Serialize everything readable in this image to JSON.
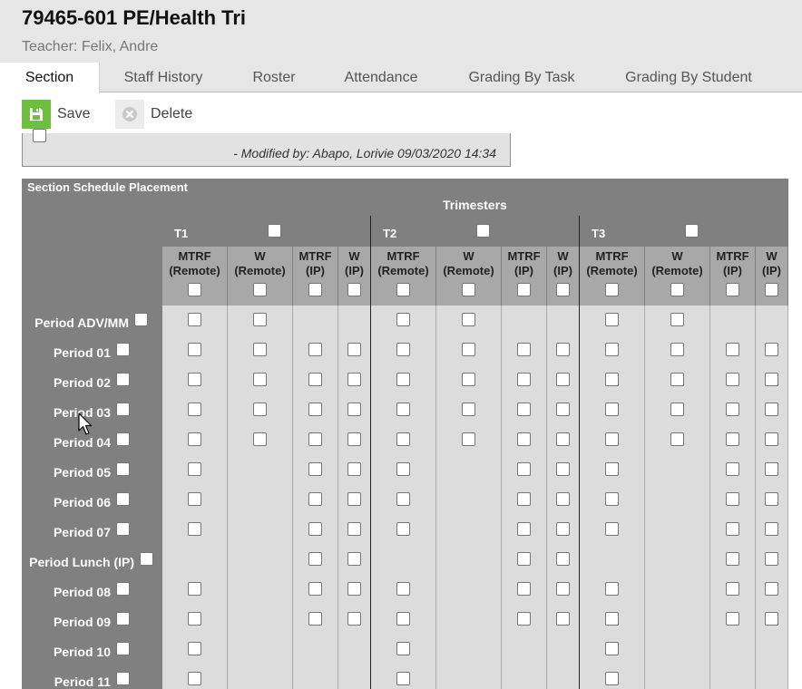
{
  "page": {
    "title": "79465-601 PE/Health Tri",
    "subtitle": "Teacher: Felix, Andre"
  },
  "tabs": [
    {
      "label": "Section",
      "active": true
    },
    {
      "label": "Staff History"
    },
    {
      "label": "Roster"
    },
    {
      "label": "Attendance"
    },
    {
      "label": "Grading By Task"
    },
    {
      "label": "Grading By Student"
    }
  ],
  "toolbar": {
    "save_label": "Save",
    "delete_label": "Delete"
  },
  "modified_text": "- Modified by: Abapo, Lorivie 09/03/2020 14:34",
  "schedule": {
    "title": "Section Schedule Placement",
    "group_title": "Trimesters",
    "terms": [
      "T1",
      "T2",
      "T3"
    ],
    "columns": [
      {
        "line1": "MTRF",
        "line2": "(Remote)"
      },
      {
        "line1": "W",
        "line2": "(Remote)"
      },
      {
        "line1": "MTRF",
        "line2": "(IP)"
      },
      {
        "line1": "W",
        "line2": "(IP)"
      }
    ],
    "periods": [
      {
        "label": "Period ADV/MM",
        "cols": [
          1,
          1,
          0,
          0
        ]
      },
      {
        "label": "Period 01",
        "cols": [
          1,
          1,
          1,
          1
        ]
      },
      {
        "label": "Period 02",
        "cols": [
          1,
          1,
          1,
          1
        ]
      },
      {
        "label": "Period 03",
        "cols": [
          1,
          1,
          1,
          1
        ]
      },
      {
        "label": "Period 04",
        "cols": [
          1,
          1,
          1,
          1
        ]
      },
      {
        "label": "Period 05",
        "cols": [
          1,
          0,
          1,
          1
        ]
      },
      {
        "label": "Period 06",
        "cols": [
          1,
          0,
          1,
          1
        ]
      },
      {
        "label": "Period 07",
        "cols": [
          1,
          0,
          1,
          1
        ]
      },
      {
        "label": "Period Lunch (IP)",
        "cols": [
          0,
          0,
          1,
          1
        ]
      },
      {
        "label": "Period 08",
        "cols": [
          1,
          0,
          1,
          1
        ]
      },
      {
        "label": "Period 09",
        "cols": [
          1,
          0,
          1,
          1
        ]
      },
      {
        "label": "Period 10",
        "cols": [
          1,
          0,
          0,
          0
        ]
      },
      {
        "label": "Period 11",
        "cols": [
          1,
          0,
          0,
          0
        ]
      }
    ]
  },
  "icons": {
    "save": "floppy-disk-icon",
    "delete": "circle-x-icon",
    "cursor": "mouse-pointer-icon"
  },
  "colors": {
    "save_accent": "#6fbf3f",
    "grid_header": "#808080",
    "column_header": "#a8a8a8",
    "cell_background": "#dcdcdc"
  }
}
